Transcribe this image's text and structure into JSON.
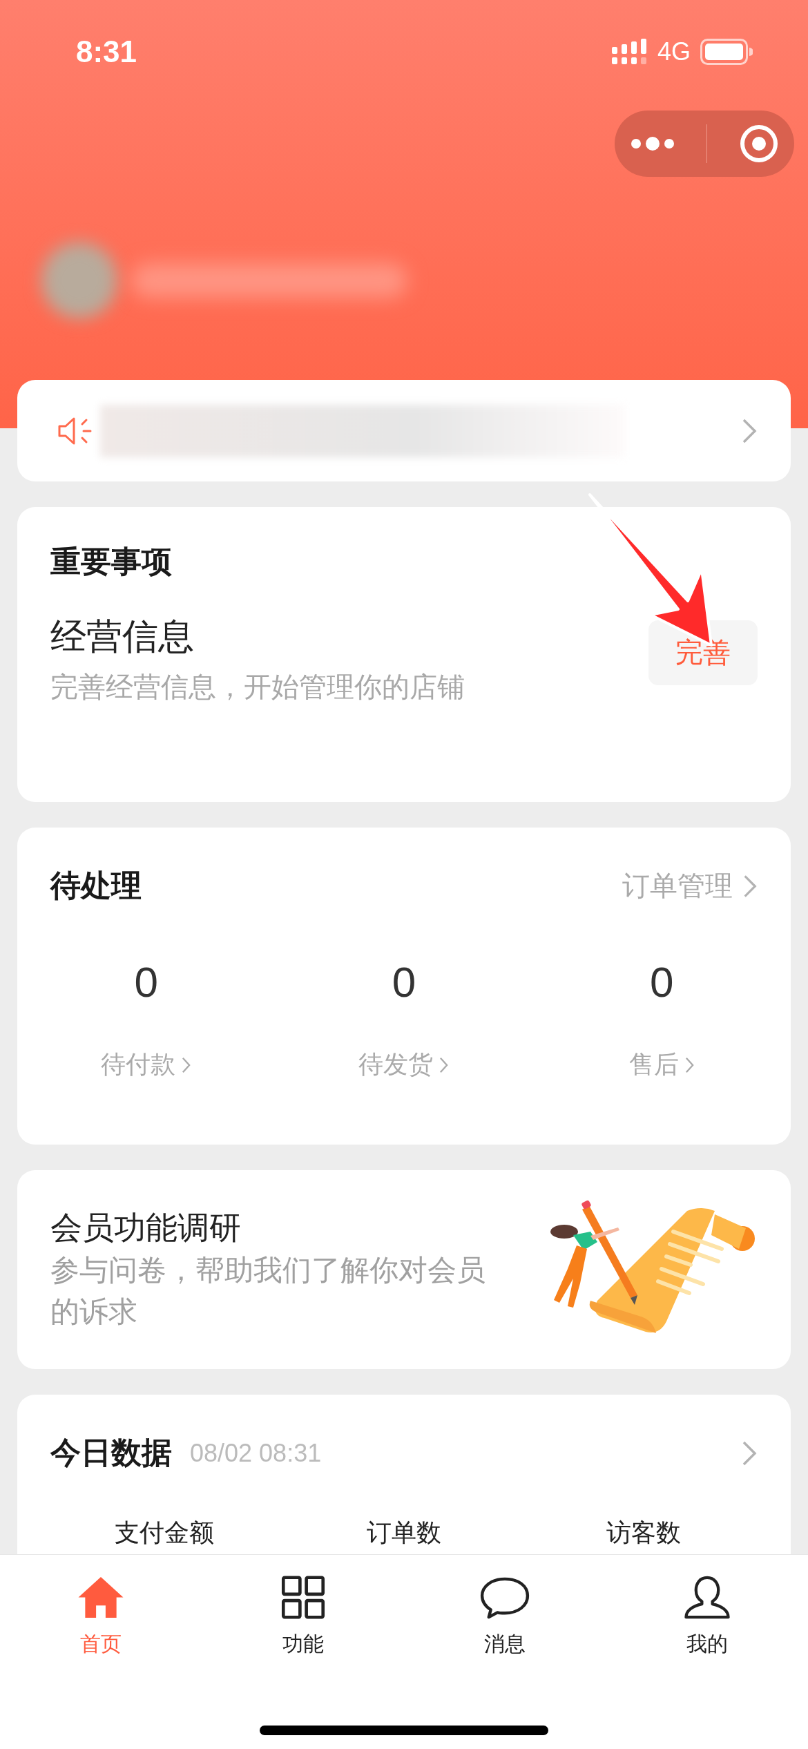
{
  "status_bar": {
    "time": "8:31",
    "network": "4G"
  },
  "important": {
    "title": "重要事项",
    "item": {
      "title": "经营信息",
      "description": "完善经营信息，开始管理你的店铺",
      "action": "完善"
    }
  },
  "pending": {
    "title": "待处理",
    "link": "订单管理",
    "stats": [
      {
        "value": "0",
        "label": "待付款"
      },
      {
        "value": "0",
        "label": "待发货"
      },
      {
        "value": "0",
        "label": "售后"
      }
    ]
  },
  "survey": {
    "title": "会员功能调研",
    "description": "参与问卷，帮助我们了解你对会员的诉求"
  },
  "today": {
    "title": "今日数据",
    "timestamp": "08/02 08:31",
    "metrics": [
      "支付金额",
      "订单数",
      "访客数"
    ]
  },
  "tab_bar": [
    {
      "label": "首页",
      "selected": true
    },
    {
      "label": "功能",
      "selected": false
    },
    {
      "label": "消息",
      "selected": false
    },
    {
      "label": "我的",
      "selected": false
    }
  ]
}
